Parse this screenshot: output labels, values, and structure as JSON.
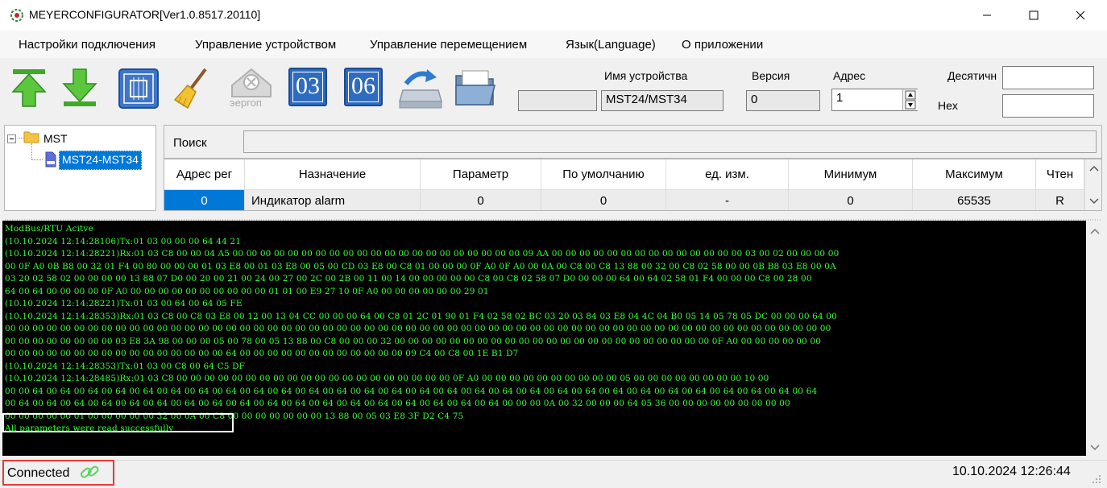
{
  "window": {
    "title": "MEYERCONFIGURATOR[Ver1.0.8517.20110]"
  },
  "menu": [
    "Настройки подключения",
    "Управление устройством",
    "Управление перемещением",
    "Язык(Language)",
    "О приложении"
  ],
  "toolbar": {
    "disabled_icon_text": "эергоп",
    "btn03": "03",
    "btn06": "06",
    "device_name_label": "Имя устройства",
    "device_name_value": "MST24/MST34",
    "version_label": "Версия",
    "version_value": "0",
    "address_label": "Адрес",
    "address_value": "1",
    "decimal_label": "Десятичн",
    "hex_label": "Hex",
    "decimal_value": "",
    "hex_value": "",
    "blank_field_value": ""
  },
  "tree": {
    "root": "MST",
    "child": "MST24-MST34"
  },
  "search": {
    "label": "Поиск",
    "value": ""
  },
  "table": {
    "columns": [
      "Адрес рег",
      "Назначение",
      "Параметр",
      "По умолчанию",
      "ед. изм.",
      "Минимум",
      "Максимум",
      "Чтен"
    ],
    "rows": [
      [
        "0",
        "Индикатор alarm",
        "0",
        "0",
        "-",
        "0",
        "65535",
        "R"
      ]
    ]
  },
  "log": [
    "ModBus/RTU Acitve",
    "(10.10.2024 12:14:28106)Tx:01 03 00 00 00 64 44 21",
    "(10.10.2024 12:14:28221)Rx:01 03 C8 00 00 04 A5 00 00 00 00 00 00 00 00 00 00 00 00 00 00 00 00 00 00 00 00 00 09 AA 00 00 00 00 00 00 00 00 00 00 00 00 00 00 03 00 02 00 00 00 00",
    "00 0F A0 0B B8 00 32 01 F4 00 80 00 00 00 01 03 E8 00 01 03 E8 00 05 00 CD 03 E8 00 C8 01 00 00 00 0F A0 0F A0 00 0A 00 C8 00 C8 13 88 00 32 00 C8 02 58 00 00 0B B8 03 E8 00 0A",
    "03 20 02 58 02 00 00 00 00 13 88 07 D0 00 20 00 21 00 24 00 27 00 2C 00 2B 00 11 00 14 00 00 00 00 00 C8 00 C8 02 58 07 D0 00 00 00 64 00 64 02 58 01 F4 00 00 00 C8 00 28 00",
    "64 00 64 00 00 00 00 0F A0 00 00 00 00 00 00 00 00 00 00 01 01 00 E9 27 10 0F A0 00 00 00 00 00 00 29 01",
    "(10.10.2024 12:14:28221)Tx:01 03 00 64 00 64 05 FE",
    "(10.10.2024 12:14:28353)Rx:01 03 C8 00 C8 03 E8 00 12 00 13 04 CC 00 00 00 64 00 C8 01 2C 01 90 01 F4 02 58 02 BC 03 20 03 84 03 E8 04 4C 04 B0 05 14 05 78 05 DC 00 00 00 64 00",
    "00 00 00 00 00 00 00 00 00 00 00 00 00 00 00 00 00 00 00 00 00 00 00 00 00 00 00 00 00 00 00 00 00 00 00 00 00 00 00 00 00 00 00 00 00 00 00 00 00 00 00 00 00 00 00 00 00 00 00 00",
    "00 00 00 00 00 00 00 00 03 E8 3A 98 00 00 00 05 00 78 00 05 13 88 00 C8 00 00 00 32 00 00 00 00 00 00 00 00 00 00 00 00 00 00 00 00 00 00 00 00 00 00 00 0F A0 00 00 00 00 00 00",
    "00 00 00 00 00 00 00 00 00 00 00 00 00 00 00 00 64 00 00 00 00 00 00 00 00 00 00 00 00 09 C4 00 C8 00 1E B1 D7",
    "(10.10.2024 12:14:28353)Tx:01 03 00 C8 00 64 C5 DF",
    "(10.10.2024 12:14:28485)Rx:01 03 C8 00 00 00 00 00 00 00 00 00 00 00 00 00 00 00 00 00 00 00 00 0F A0 00 00 00 00 00 00 00 00 00 00 05 00 00 00 00 00 00 00 00 10 00",
    "00 00 64 00 64 00 64 00 64 00 64 00 64 00 64 00 64 00 64 00 64 00 64 00 64 00 64 00 64 00 64 00 64 00 64 00 64 00 64 00 64 00 64 00 64 00 64 00 64 00 64 00 64 00 64 00 64 00 64",
    "00 64 00 64 00 64 00 64 00 64 00 64 00 64 00 64 00 64 00 64 00 64 00 64 00 64 00 64 00 64 00 64 00 64 00 64 00 00 00 0A 00 32 00 00 00 64 05 36 00 00 00 00 00 00 00 00 00",
    "00 00 00 00 00 01 00 00 00 00 00 32 00 0A 00 C8 00 00 00 00 00 00 00 13 88 00 05 03 E8 3F D2 C4 75",
    "All parameters were read successfully"
  ],
  "status": {
    "connection": "Connected",
    "datetime": "10.10.2024 12:26:44"
  },
  "colors": {
    "log_background": "#000000",
    "log_text": "#35ff35",
    "selection": "#0078d7",
    "connected_border": "#e53935",
    "link_icon": "#5bd35b"
  }
}
